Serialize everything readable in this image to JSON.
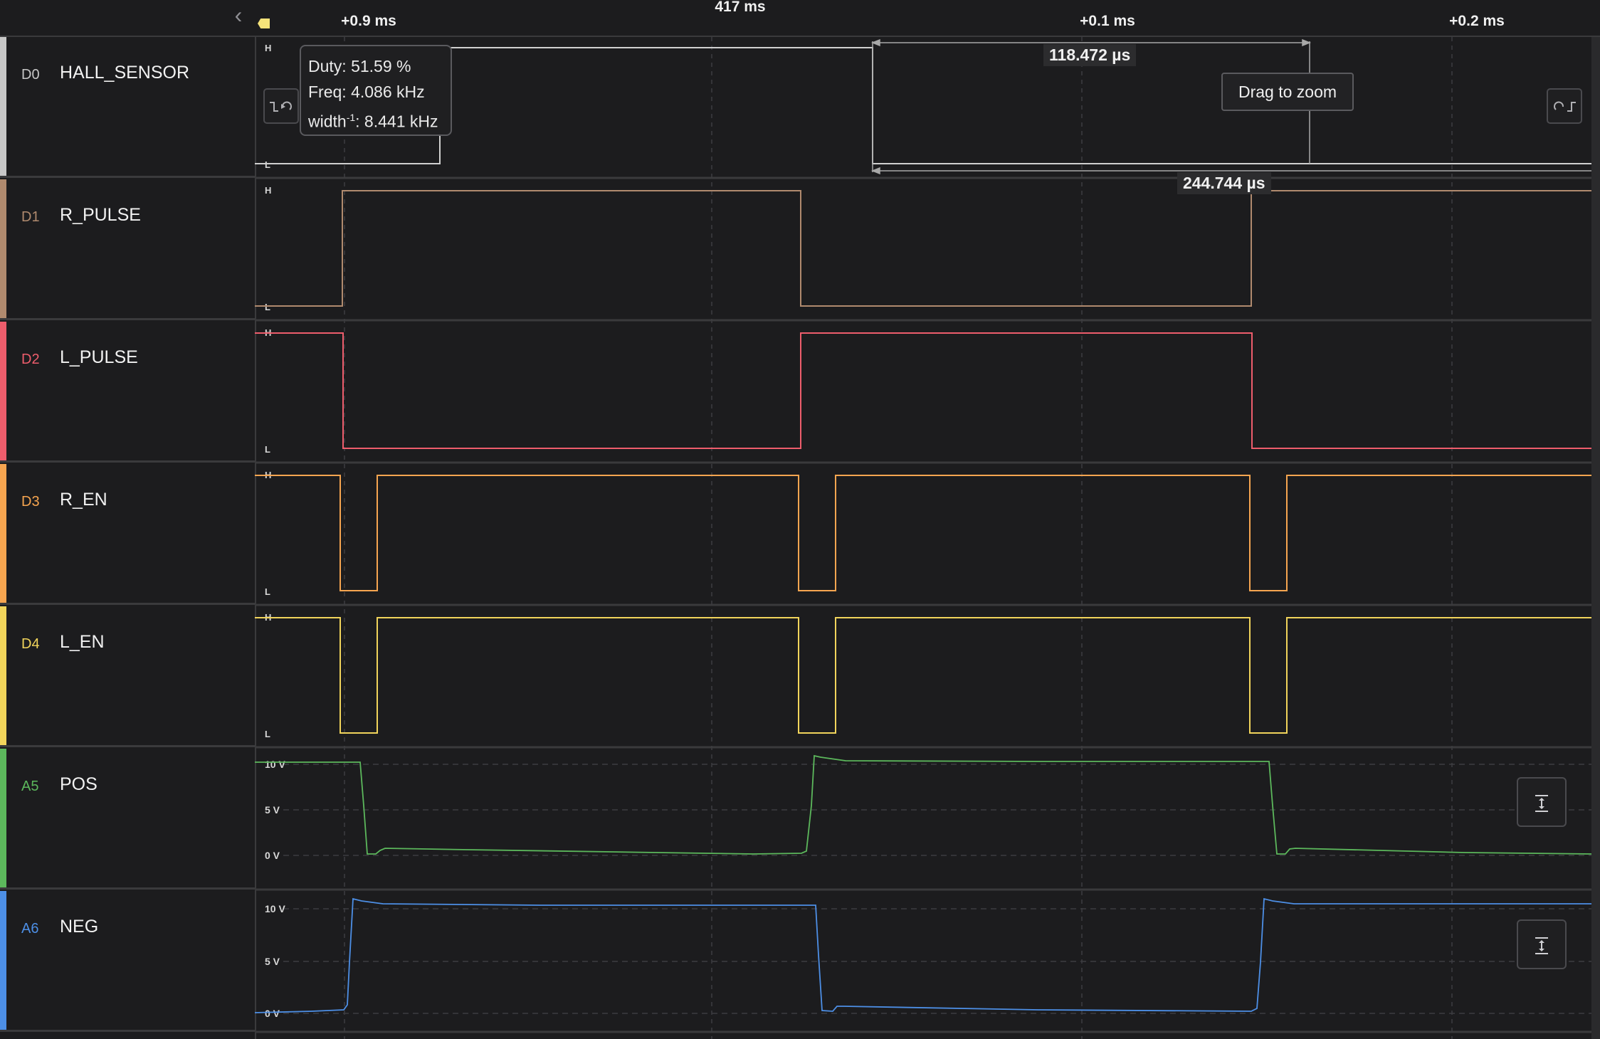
{
  "header": {
    "cursor_time": "417 ms",
    "ruler": [
      {
        "label": "+0.9 ms"
      },
      {
        "label": "+0.1 ms"
      },
      {
        "label": "+0.2 ms"
      }
    ],
    "collapse_icon": "chevron-left-icon",
    "marker_icon": "marker-flag-icon"
  },
  "channels": [
    {
      "id": "D0",
      "name": "HALL_SENSOR",
      "color": "#c7c7c7",
      "kind": "digital"
    },
    {
      "id": "D1",
      "name": "R_PULSE",
      "color": "#b08a6e",
      "kind": "digital"
    },
    {
      "id": "D2",
      "name": "L_PULSE",
      "color": "#ee5d6c",
      "kind": "digital"
    },
    {
      "id": "D3",
      "name": "R_EN",
      "color": "#f6a550",
      "kind": "digital"
    },
    {
      "id": "D4",
      "name": "L_EN",
      "color": "#f1d45b",
      "kind": "digital"
    },
    {
      "id": "A5",
      "name": "POS",
      "color": "#5cb85c",
      "kind": "analog"
    },
    {
      "id": "A6",
      "name": "NEG",
      "color": "#4d8fe6",
      "kind": "analog"
    }
  ],
  "levels": {
    "high": "H",
    "low": "L"
  },
  "analog_ticks": [
    "10 V",
    "5 V",
    "0 V"
  ],
  "tooltip": {
    "duty": "Duty: 51.59 %",
    "freq": "Freq: 4.086 kHz",
    "width_prefix": "width",
    "width_sup": "-1",
    "width_value": ": 8.441 kHz"
  },
  "measurements": {
    "width": "118.472 µs",
    "period": "244.744 µs"
  },
  "drag_to_zoom": "Drag to zoom",
  "buttons": {
    "prev_edge_icon": "previous-edge-icon",
    "next_edge_icon": "next-edge-icon",
    "autoscale_icon": "vertical-fit-icon"
  }
}
